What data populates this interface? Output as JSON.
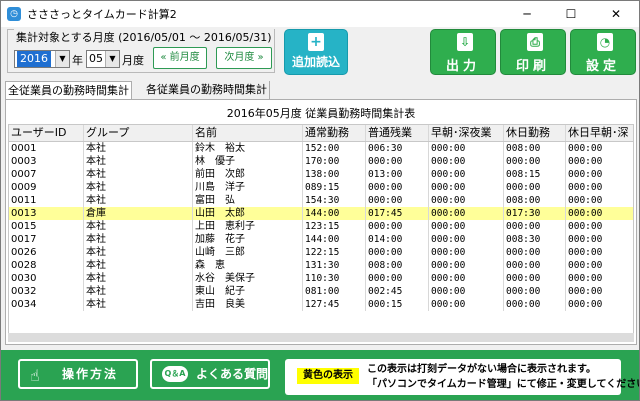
{
  "window": {
    "title": "さささっとタイムカード計算2",
    "app_icon_glyph": "◷",
    "minimize_glyph": "─",
    "maximize_glyph": "☐",
    "close_glyph": "✕"
  },
  "period": {
    "label": "集計対象とする月度 (2016/05/01 〜 2016/05/31)",
    "year": "2016",
    "year_unit": "年",
    "month": "05",
    "month_unit": "月度",
    "dropdown_glyph": "▼",
    "prev_label": "« 前月度",
    "next_label": "次月度 »"
  },
  "toolbar": {
    "add_icon": "+",
    "add_label": "追加読込",
    "output_icon": "⇩",
    "output_label": "出力",
    "print_icon": "⎙",
    "print_label": "印刷",
    "settings_icon": "◔",
    "settings_label": "設定"
  },
  "tabs": [
    {
      "label": "全従業員の勤務時間集計"
    },
    {
      "label": "各従業員の勤務時間集計"
    }
  ],
  "report": {
    "title": "2016年05月度 従業員勤務時間集計表",
    "columns": [
      "ユーザーID",
      "グループ",
      "名前",
      "通常勤務",
      "普通残業",
      "早朝･深夜業",
      "休日勤務",
      "休日早朝･深"
    ],
    "rows": [
      [
        "0001",
        "本社",
        "鈴木　裕太",
        "152:00",
        "006:30",
        "000:00",
        "008:00",
        "000:00"
      ],
      [
        "0003",
        "本社",
        "林　優子",
        "170:00",
        "000:00",
        "000:00",
        "000:00",
        "000:00"
      ],
      [
        "0007",
        "本社",
        "前田　次郎",
        "138:00",
        "013:00",
        "000:00",
        "008:15",
        "000:00"
      ],
      [
        "0009",
        "本社",
        "川島　洋子",
        "089:15",
        "000:00",
        "000:00",
        "000:00",
        "000:00"
      ],
      [
        "0011",
        "本社",
        "富田　弘",
        "154:30",
        "000:00",
        "000:00",
        "008:00",
        "000:00"
      ],
      [
        "0013",
        "倉庫",
        "山田　太郎",
        "144:00",
        "017:45",
        "000:00",
        "017:30",
        "000:00"
      ],
      [
        "0015",
        "本社",
        "上田　恵利子",
        "123:15",
        "000:00",
        "000:00",
        "000:00",
        "000:00"
      ],
      [
        "0017",
        "本社",
        "加藤　花子",
        "144:00",
        "014:00",
        "000:00",
        "008:30",
        "000:00"
      ],
      [
        "0026",
        "本社",
        "山崎　三郎",
        "122:15",
        "000:00",
        "000:00",
        "000:00",
        "000:00"
      ],
      [
        "0028",
        "本社",
        "森　恵",
        "131:30",
        "008:00",
        "000:00",
        "000:00",
        "000:00"
      ],
      [
        "0030",
        "本社",
        "水谷　美保子",
        "110:30",
        "000:00",
        "000:00",
        "000:00",
        "000:00"
      ],
      [
        "0032",
        "本社",
        "東山　紀子",
        "081:00",
        "002:45",
        "000:00",
        "000:00",
        "000:00"
      ],
      [
        "0034",
        "本社",
        "吉田　良美",
        "127:45",
        "000:15",
        "000:00",
        "000:00",
        "000:00"
      ]
    ],
    "highlight_row_index": 5,
    "highlight_color": "#ffff99"
  },
  "footer": {
    "manual_icon": "☝",
    "manual_label": "操作方法",
    "faq_icon": "Q＆A",
    "faq_label": "よくある質問",
    "notice_badge": "黄色の表示",
    "notice_line1": "この表示は打刻データがない場合に表示されます。",
    "notice_line2": "「パソコンでタイムカード管理」にて修正・変更してください。"
  },
  "colors": {
    "accent_green": "#2fae4e",
    "accent_teal": "#26b3c6",
    "footer_green": "#2aa352"
  }
}
